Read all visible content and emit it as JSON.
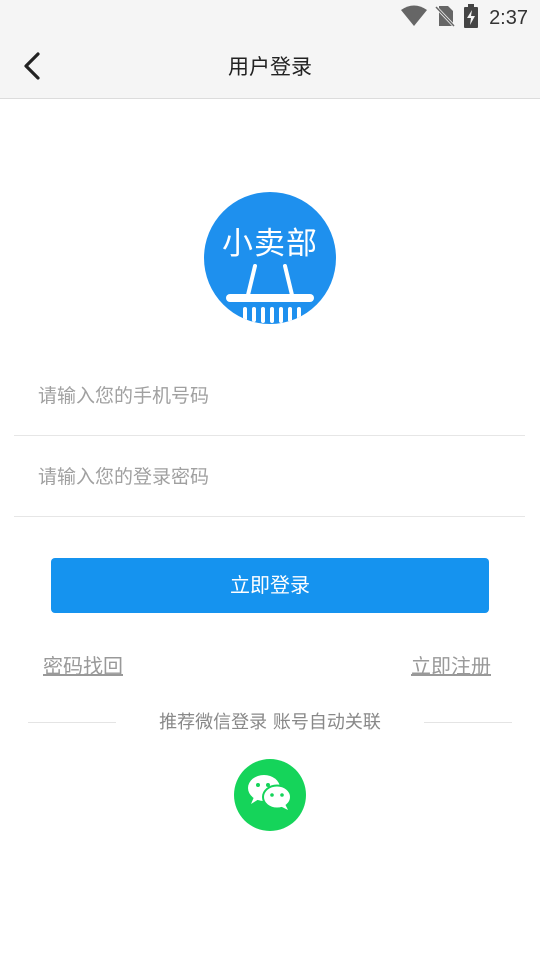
{
  "status_bar": {
    "time": "2:37",
    "icons": [
      "wifi-icon",
      "no-sim-icon",
      "battery-charging-icon"
    ]
  },
  "header": {
    "title": "用户登录",
    "back_icon": "chevron-left-icon"
  },
  "logo": {
    "text": "小卖部",
    "icon": "shopping-basket-icon",
    "color": "#1e90ee"
  },
  "form": {
    "phone_placeholder": "请输入您的手机号码",
    "phone_value": "",
    "password_placeholder": "请输入您的登录密码",
    "password_value": "",
    "login_label": "立即登录"
  },
  "links": {
    "forgot_password": "密码找回",
    "register": "立即注册"
  },
  "social": {
    "divider_text": "推荐微信登录 账号自动关联",
    "wechat_icon": "wechat-icon",
    "wechat_color": "#15d45a"
  },
  "colors": {
    "primary": "#1593ef",
    "link_gray": "#999999"
  }
}
